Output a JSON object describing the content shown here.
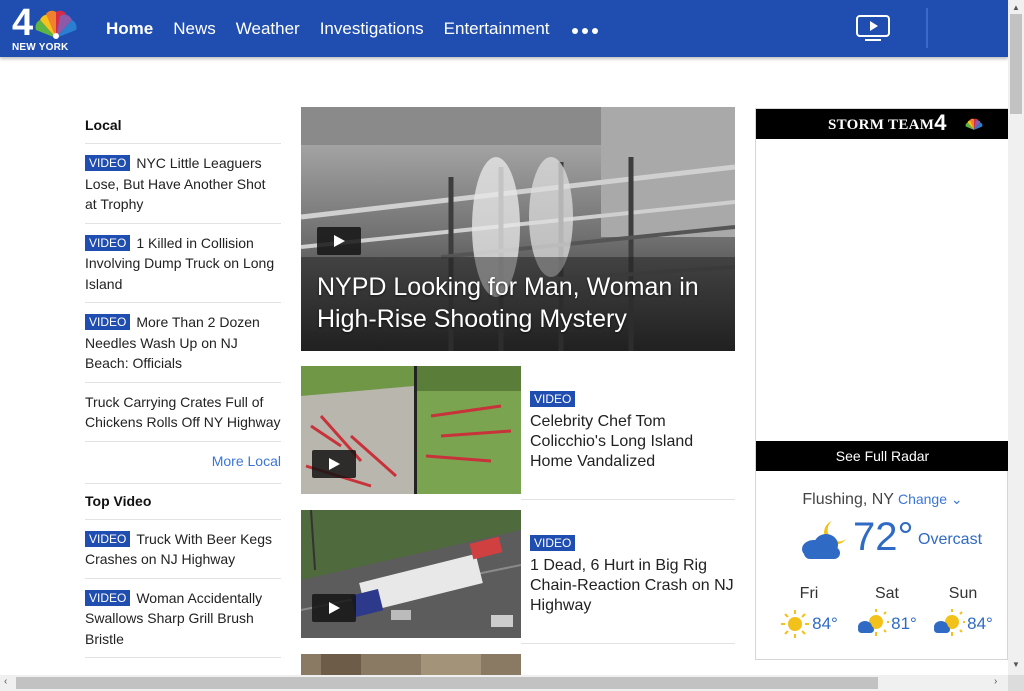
{
  "header": {
    "logo_number": "4",
    "logo_text": "NEW YORK",
    "nav": [
      "Home",
      "News",
      "Weather",
      "Investigations",
      "Entertainment"
    ],
    "icons": {
      "more": "more-dots-icon",
      "video": "tv-play-icon"
    },
    "color": "#1f4db0"
  },
  "left": {
    "local_title": "Local",
    "local_stories": [
      {
        "badge": "VIDEO",
        "text": "NYC Little Leaguers Lose, But Have Another Shot at Trophy"
      },
      {
        "badge": "VIDEO",
        "text": "1 Killed in Collision Involving Dump Truck on Long Island"
      },
      {
        "badge": "VIDEO",
        "text": "More Than 2 Dozen Needles Wash Up on NJ Beach: Officials"
      },
      {
        "badge": "",
        "text": "Truck Carrying Crates Full of Chickens Rolls Off NY Highway"
      }
    ],
    "more_local": "More Local",
    "video_title": "Top Video",
    "video_stories": [
      {
        "badge": "VIDEO",
        "text": "Truck With Beer Kegs Crashes on NJ Highway"
      },
      {
        "badge": "VIDEO",
        "text": "Woman Accidentally Swallows Sharp Grill Brush Bristle"
      }
    ]
  },
  "main": {
    "hero_headline": "NYPD Looking for Man, Woman in High-Rise Shooting Mystery",
    "cards": [
      {
        "badge": "VIDEO",
        "headline": "Celebrity Chef Tom Colicchio's Long Island Home Vandalized"
      },
      {
        "badge": "VIDEO",
        "headline": "1 Dead, 6 Hurt in Big Rig Chain-Reaction Crash on NJ Highway"
      }
    ]
  },
  "weather": {
    "header": "STORM TEAM",
    "header_number": "4",
    "radar_label": "See Full Radar",
    "location": "Flushing, NY",
    "change_label": "Change",
    "current_temp": "72°",
    "current_condition": "Overcast",
    "forecast": [
      {
        "day": "Fri",
        "temp": "84°",
        "icon": "sunny-icon"
      },
      {
        "day": "Sat",
        "temp": "81°",
        "icon": "partly-sunny-icon"
      },
      {
        "day": "Sun",
        "temp": "84°",
        "icon": "partly-sunny-icon"
      }
    ]
  }
}
